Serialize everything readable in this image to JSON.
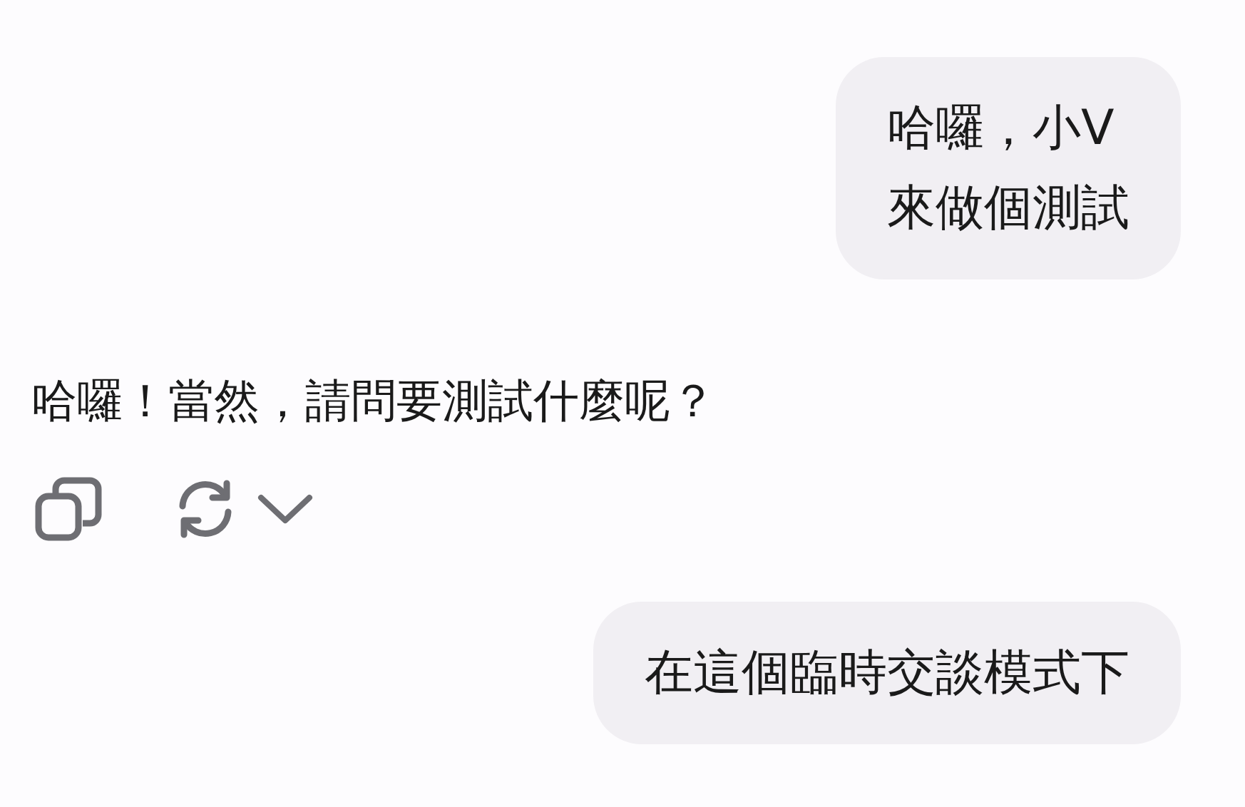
{
  "messages": [
    {
      "kind": "bubble",
      "text": "哈囉，小V\n來做個測試"
    },
    {
      "kind": "reply",
      "text": "哈囉！當然，請問要測試什麼呢？"
    },
    {
      "kind": "bubble",
      "text": "在這個臨時交談模式下"
    }
  ]
}
